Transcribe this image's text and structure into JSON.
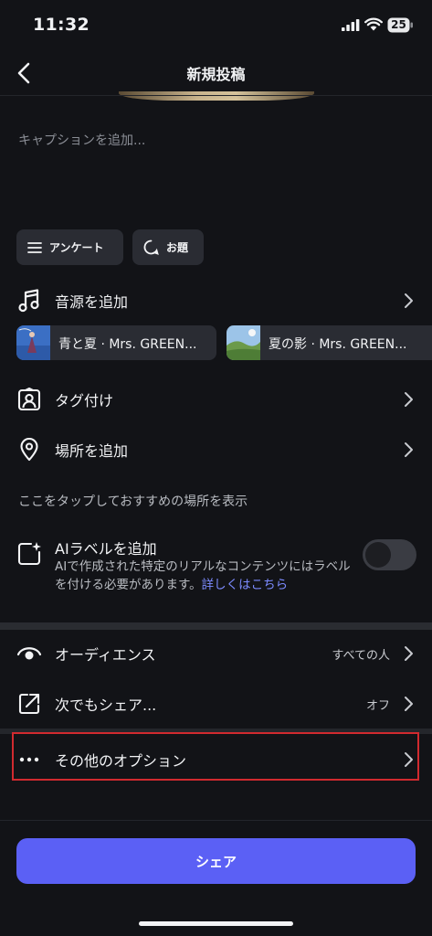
{
  "status_bar": {
    "time": "11:32",
    "battery": "25"
  },
  "header": {
    "title": "新規投稿"
  },
  "caption": {
    "placeholder": "キャプションを追加..."
  },
  "chips": {
    "poll": "アンケート",
    "topic": "お題"
  },
  "music": {
    "label": "音源を追加",
    "tracks": [
      {
        "title": "青と夏 · Mrs. GREEN..."
      },
      {
        "title": "夏の影 · Mrs. GREEN..."
      }
    ]
  },
  "tag": {
    "label": "タグ付け"
  },
  "location": {
    "label": "場所を追加",
    "suggestion": "ここをタップしておすすめの場所を表示"
  },
  "ai_label": {
    "title": "AIラベルを追加",
    "description": "AIで作成された特定のリアルなコンテンツにはラベルを付ける必要があります。",
    "link": "詳しくはこちら",
    "enabled": false
  },
  "audience": {
    "label": "オーディエンス",
    "value": "すべての人"
  },
  "crosspost": {
    "label": "次でもシェア...",
    "value": "オフ"
  },
  "more_options": {
    "label": "その他のオプション"
  },
  "share_button": {
    "label": "シェア"
  },
  "colors": {
    "accent": "#5b60f5",
    "link": "#7c8bff",
    "highlight": "#d12a2f",
    "background": "#121317"
  }
}
